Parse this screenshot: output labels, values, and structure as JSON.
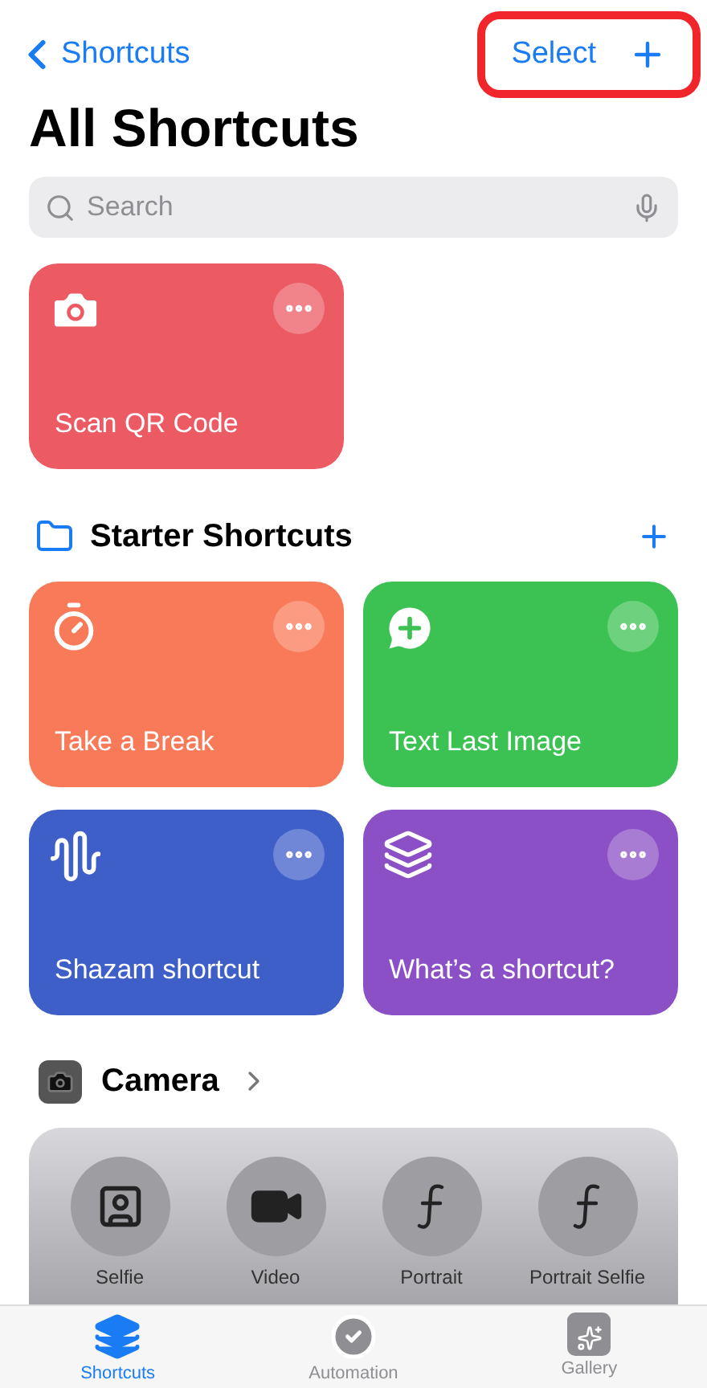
{
  "nav": {
    "back_label": "Shortcuts",
    "select_label": "Select"
  },
  "title": "All Shortcuts",
  "search": {
    "placeholder": "Search"
  },
  "top_shortcuts": [
    {
      "name": "Scan QR Code",
      "color": "#ec5a63"
    }
  ],
  "folder": {
    "title": "Starter Shortcuts"
  },
  "starter_shortcuts": [
    {
      "name": "Take a Break",
      "color": "#f87a58"
    },
    {
      "name": "Text Last Image",
      "color": "#3cc253"
    },
    {
      "name": "Shazam shortcut",
      "color": "#3f5fc8"
    },
    {
      "name": "What’s a shortcut?",
      "color": "#8b50c5"
    }
  ],
  "camera": {
    "title": "Camera",
    "actions": [
      {
        "label": "Selfie"
      },
      {
        "label": "Video"
      },
      {
        "label": "Portrait"
      },
      {
        "label": "Portrait Selfie"
      }
    ]
  },
  "tab_bar": [
    {
      "label": "Shortcuts",
      "selected": true
    },
    {
      "label": "Automation",
      "selected": false
    },
    {
      "label": "Gallery",
      "selected": false
    }
  ]
}
